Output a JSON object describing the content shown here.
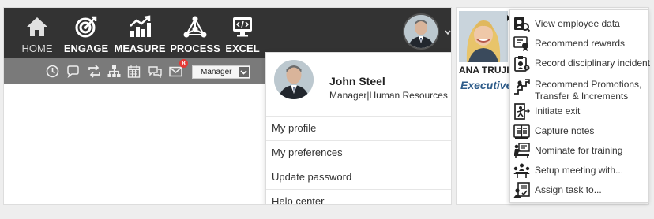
{
  "nav": {
    "items": [
      {
        "label": "HOME",
        "icon": "home-icon"
      },
      {
        "label": "ENGAGE",
        "icon": "target-icon"
      },
      {
        "label": "MEASURE",
        "icon": "chart-icon"
      },
      {
        "label": "PROCESS",
        "icon": "network-icon"
      },
      {
        "label": "EXCEL",
        "icon": "code-monitor-icon"
      }
    ]
  },
  "toolbar": {
    "icons": [
      "clock-icon",
      "chat-icon",
      "refresh-icon",
      "org-chart-icon",
      "calendar-icon",
      "comments-icon",
      "mail-icon"
    ],
    "mail_badge": "8",
    "role_select": "Manager"
  },
  "profile_menu": {
    "name": "John Steel",
    "role": "Manager|Human Resources",
    "items": [
      "My profile",
      "My preferences",
      "Update password",
      "Help center"
    ]
  },
  "employee": {
    "name": "ANA TRUJILL",
    "title": "Executive"
  },
  "action_menu": {
    "items": [
      {
        "label": "View employee data",
        "icon": "employee-data-icon"
      },
      {
        "label": "Recommend rewards",
        "icon": "rewards-icon"
      },
      {
        "label": "Record disciplinary incident",
        "icon": "clipboard-icon"
      },
      {
        "label": "Recommend Promotions,",
        "label2": "Transfer & Increments",
        "icon": "promotion-icon"
      },
      {
        "label": "Initiate exit",
        "icon": "exit-icon"
      },
      {
        "label": "Capture notes",
        "icon": "notes-icon"
      },
      {
        "label": "Nominate for training",
        "icon": "training-icon"
      },
      {
        "label": "Setup meeting with...",
        "icon": "meeting-icon"
      },
      {
        "label": "Assign task to...",
        "icon": "assign-task-icon"
      }
    ]
  },
  "colors": {
    "topbar": "#333333",
    "subbar": "#7a7a7a",
    "badge": "#e53935",
    "title_blue": "#2e5c8a"
  }
}
